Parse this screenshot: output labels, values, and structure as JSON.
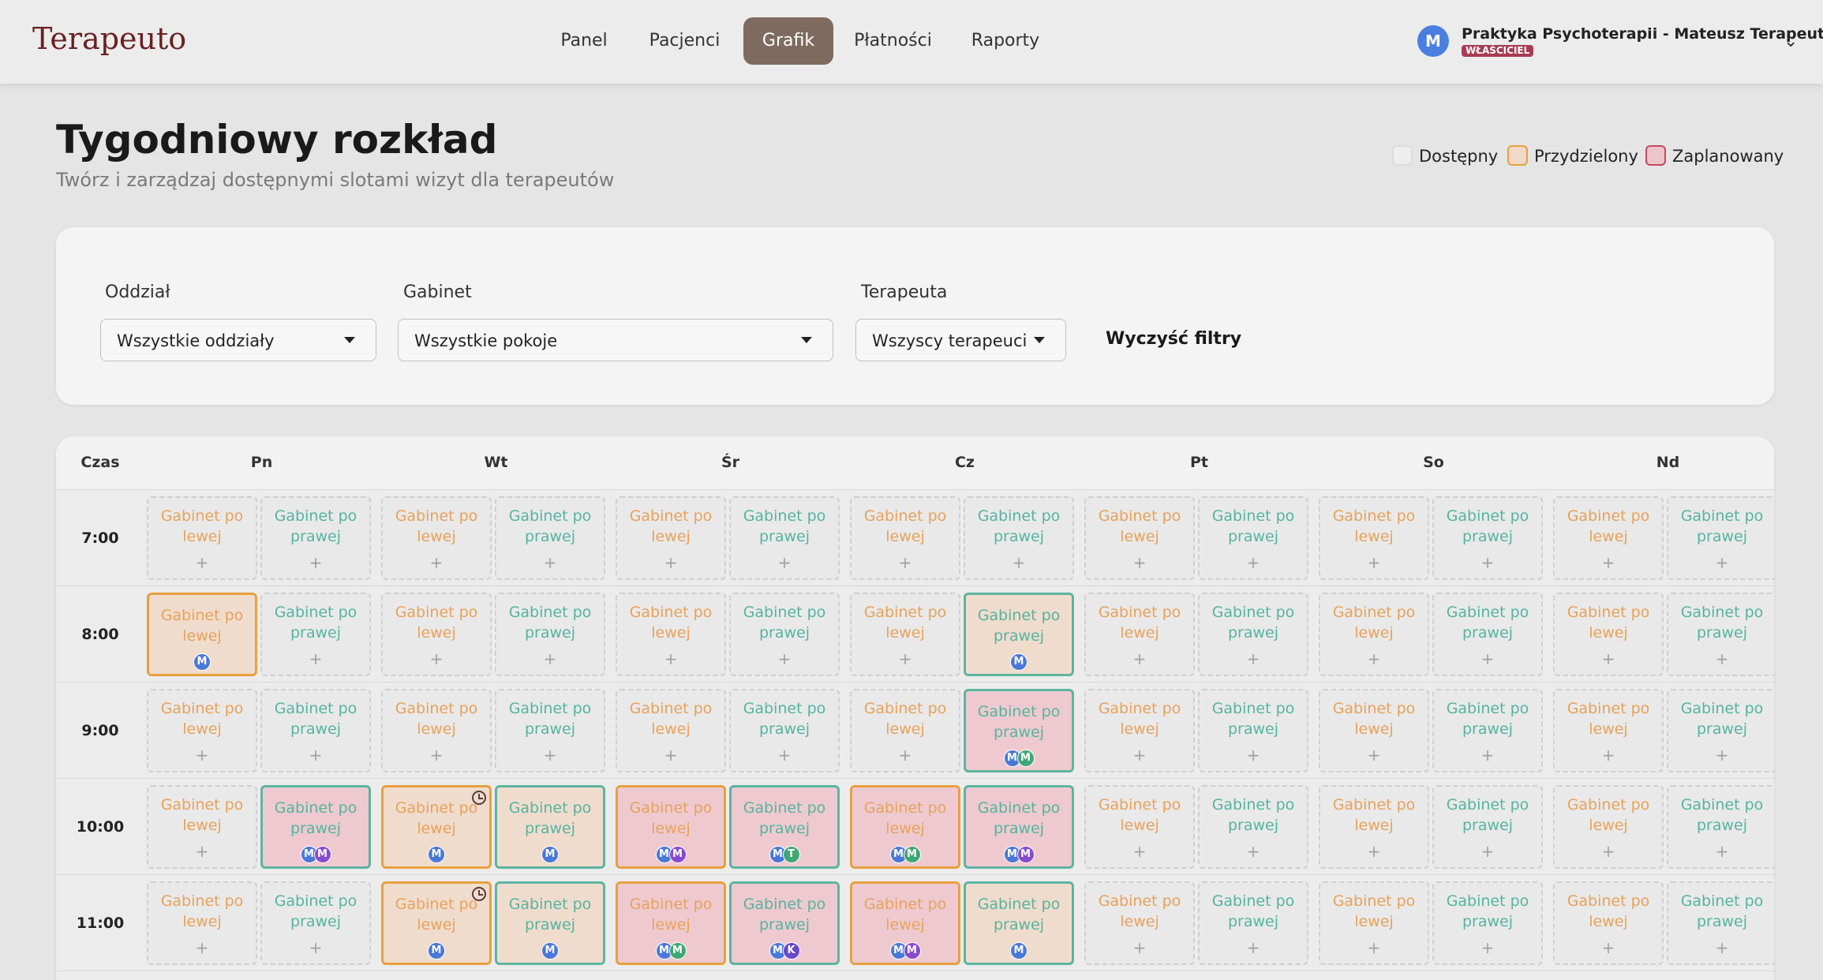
{
  "brand": "Terapeuto",
  "nav": [
    {
      "label": "Panel",
      "active": false
    },
    {
      "label": "Pacjenci",
      "active": false
    },
    {
      "label": "Grafik",
      "active": true
    },
    {
      "label": "Płatności",
      "active": false
    },
    {
      "label": "Raporty",
      "active": false
    }
  ],
  "account": {
    "avatar": "M",
    "name": "Praktyka Psychoterapii - Mateusz Terapeuto",
    "role": "WŁAŚCICIEL"
  },
  "header": {
    "title": "Tygodniowy rozkład",
    "subtitle": "Twórz i zarządzaj dostępnymi slotami wizyt dla terapeutów"
  },
  "legend": [
    {
      "label": "Dostępny",
      "border": "#dcdcdc",
      "fill": "#eeeeee"
    },
    {
      "label": "Przydzielony",
      "border": "#e8a040",
      "fill": "#f0d9c6"
    },
    {
      "label": "Zaplanowany",
      "border": "#c44a5e",
      "fill": "#ecc4cc"
    }
  ],
  "filters": {
    "branch": {
      "label": "Oddział",
      "value": "Wszystkie oddziały"
    },
    "room": {
      "label": "Gabinet",
      "value": "Wszystkie pokoje"
    },
    "therapist": {
      "label": "Terapeuta",
      "value": "Wszyscy terapeuci"
    },
    "clear_label": "Wyczyść filtry"
  },
  "grid": {
    "time_header": "Czas",
    "days": [
      "Pn",
      "Wt",
      "Śr",
      "Cz",
      "Pt",
      "So",
      "Nd"
    ],
    "rooms": [
      {
        "name": "Gabinet po lewej",
        "line1": "Gabinet po",
        "line2": "lewej",
        "side": "left"
      },
      {
        "name": "Gabinet po prawej",
        "line1": "Gabinet po",
        "line2": "prawej",
        "side": "right"
      }
    ],
    "add_glyph": "+",
    "avatar_colors": {
      "M": "#4a78d8",
      "M2": "#8a4ad0",
      "M3": "#3fa774",
      "T": "#3fa774",
      "K": "#6a48c8"
    },
    "rows": [
      {
        "time": "7:00",
        "slots": {}
      },
      {
        "time": "8:00",
        "slots": {
          "0-0": {
            "status": "assigned",
            "avatars": [
              "M"
            ]
          },
          "3-1": {
            "status": "assigned",
            "avatars": [
              "M"
            ]
          }
        }
      },
      {
        "time": "9:00",
        "slots": {
          "3-1": {
            "status": "planned",
            "avatars": [
              "M",
              "M3"
            ]
          }
        }
      },
      {
        "time": "10:00",
        "slots": {
          "0-1": {
            "status": "planned",
            "avatars": [
              "M",
              "M2"
            ]
          },
          "1-0": {
            "status": "assigned",
            "avatars": [
              "M"
            ],
            "clock": true
          },
          "1-1": {
            "status": "assigned",
            "avatars": [
              "M"
            ]
          },
          "2-0": {
            "status": "planned",
            "avatars": [
              "M",
              "M2"
            ]
          },
          "2-1": {
            "status": "planned",
            "avatars": [
              "M",
              "T"
            ]
          },
          "3-0": {
            "status": "planned",
            "avatars": [
              "M",
              "M3"
            ]
          },
          "3-1": {
            "status": "planned",
            "avatars": [
              "M",
              "M2"
            ]
          }
        }
      },
      {
        "time": "11:00",
        "slots": {
          "1-0": {
            "status": "assigned",
            "avatars": [
              "M"
            ],
            "clock": true
          },
          "1-1": {
            "status": "assigned",
            "avatars": [
              "M"
            ]
          },
          "2-0": {
            "status": "planned",
            "avatars": [
              "M",
              "M3"
            ]
          },
          "2-1": {
            "status": "planned",
            "avatars": [
              "M",
              "K"
            ]
          },
          "3-0": {
            "status": "planned",
            "avatars": [
              "M",
              "M2"
            ]
          },
          "3-1": {
            "status": "assigned",
            "avatars": [
              "M"
            ]
          }
        }
      }
    ]
  }
}
